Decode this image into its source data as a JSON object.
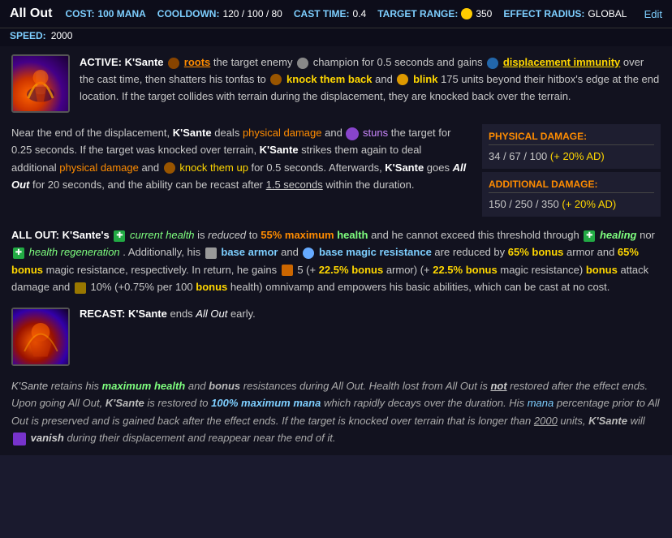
{
  "header": {
    "ability_name": "All Out",
    "cost_label": "COST:",
    "cost_value": "100 MANA",
    "cooldown_label": "COOLDOWN:",
    "cooldown_value": "120 / 100 / 80",
    "cast_time_label": "CAST TIME:",
    "cast_time_value": "0.4",
    "target_range_label": "TARGET RANGE:",
    "target_range_value": "350",
    "effect_radius_label": "EFFECT RADIUS:",
    "effect_radius_value": "GLOBAL",
    "speed_label": "SPEED:",
    "speed_value": "2000",
    "edit_label": "Edit"
  },
  "active_section": {
    "label": "ACTIVE:",
    "text_parts": [
      {
        "text": "K'Sante ",
        "style": "white"
      },
      {
        "text": "roots",
        "style": "orange",
        "underline": true
      },
      {
        "text": " the target enemy ",
        "style": "normal"
      },
      {
        "text": "champion",
        "style": "normal"
      },
      {
        "text": " for 0.5 seconds and gains ",
        "style": "normal"
      },
      {
        "text": "displacement immunity",
        "style": "yellow",
        "underline": true
      },
      {
        "text": " over the cast time, then shatters his tonfas to ",
        "style": "normal"
      },
      {
        "text": "knock them back",
        "style": "yellow"
      },
      {
        "text": " and ",
        "style": "normal"
      },
      {
        "text": "blink",
        "style": "yellow"
      },
      {
        "text": " 175 units beyond their hitbox's edge at the end location. If the target collides with terrain during the displacement, they are knocked back over the terrain.",
        "style": "normal"
      }
    ]
  },
  "middle_text": {
    "paragraph1": "Near the end of the displacement, K'Sante deals physical damage and stuns the target for 0.25 seconds. If the target was knocked over terrain, K'Sante strikes them again to deal additional physical damage and knock them up for 0.5 seconds. Afterwards, K'Sante goes All Out for 20 seconds, and the ability can be recast after 1.5 seconds within the duration.",
    "allout_paragraph": "ALL OUT: K'Sante's current health is reduced to 55% maximum health and he cannot exceed this threshold through healing nor health regeneration. Additionally, his base armor and base magic resistance are reduced by 65% bonus armor and 65% bonus magic resistance, respectively. In return, he gains 5 (+ 22.5% bonus armor) (+ 22.5% bonus magic resistance) bonus attack damage and 10% (+0.75% per 100 bonus health) omnivamp and empowers his basic abilities, which can be cast at no cost."
  },
  "damage": {
    "physical_label": "PHYSICAL DAMAGE:",
    "physical_values": "34 / 67 / 100",
    "physical_ad": "(+ 20% AD)",
    "additional_label": "ADDITIONAL DAMAGE:",
    "additional_values": "150 / 250 / 350",
    "additional_ad": "(+ 20% AD)"
  },
  "recast": {
    "label": "RECAST:",
    "text": "K'Sante ends All Out early."
  },
  "footer": {
    "text": "K'Sante retains his maximum health and bonus resistances during All Out. Health lost from All Out is not restored after the effect ends. Upon going All Out, K'Sante is restored to 100% maximum mana which rapidly decays over the duration. His mana percentage prior to All Out is preserved and is gained back after the effect ends. If the target is knocked over terrain that is longer than 2000 units, K'Sante will vanish during their displacement and reappear near the end of it."
  }
}
